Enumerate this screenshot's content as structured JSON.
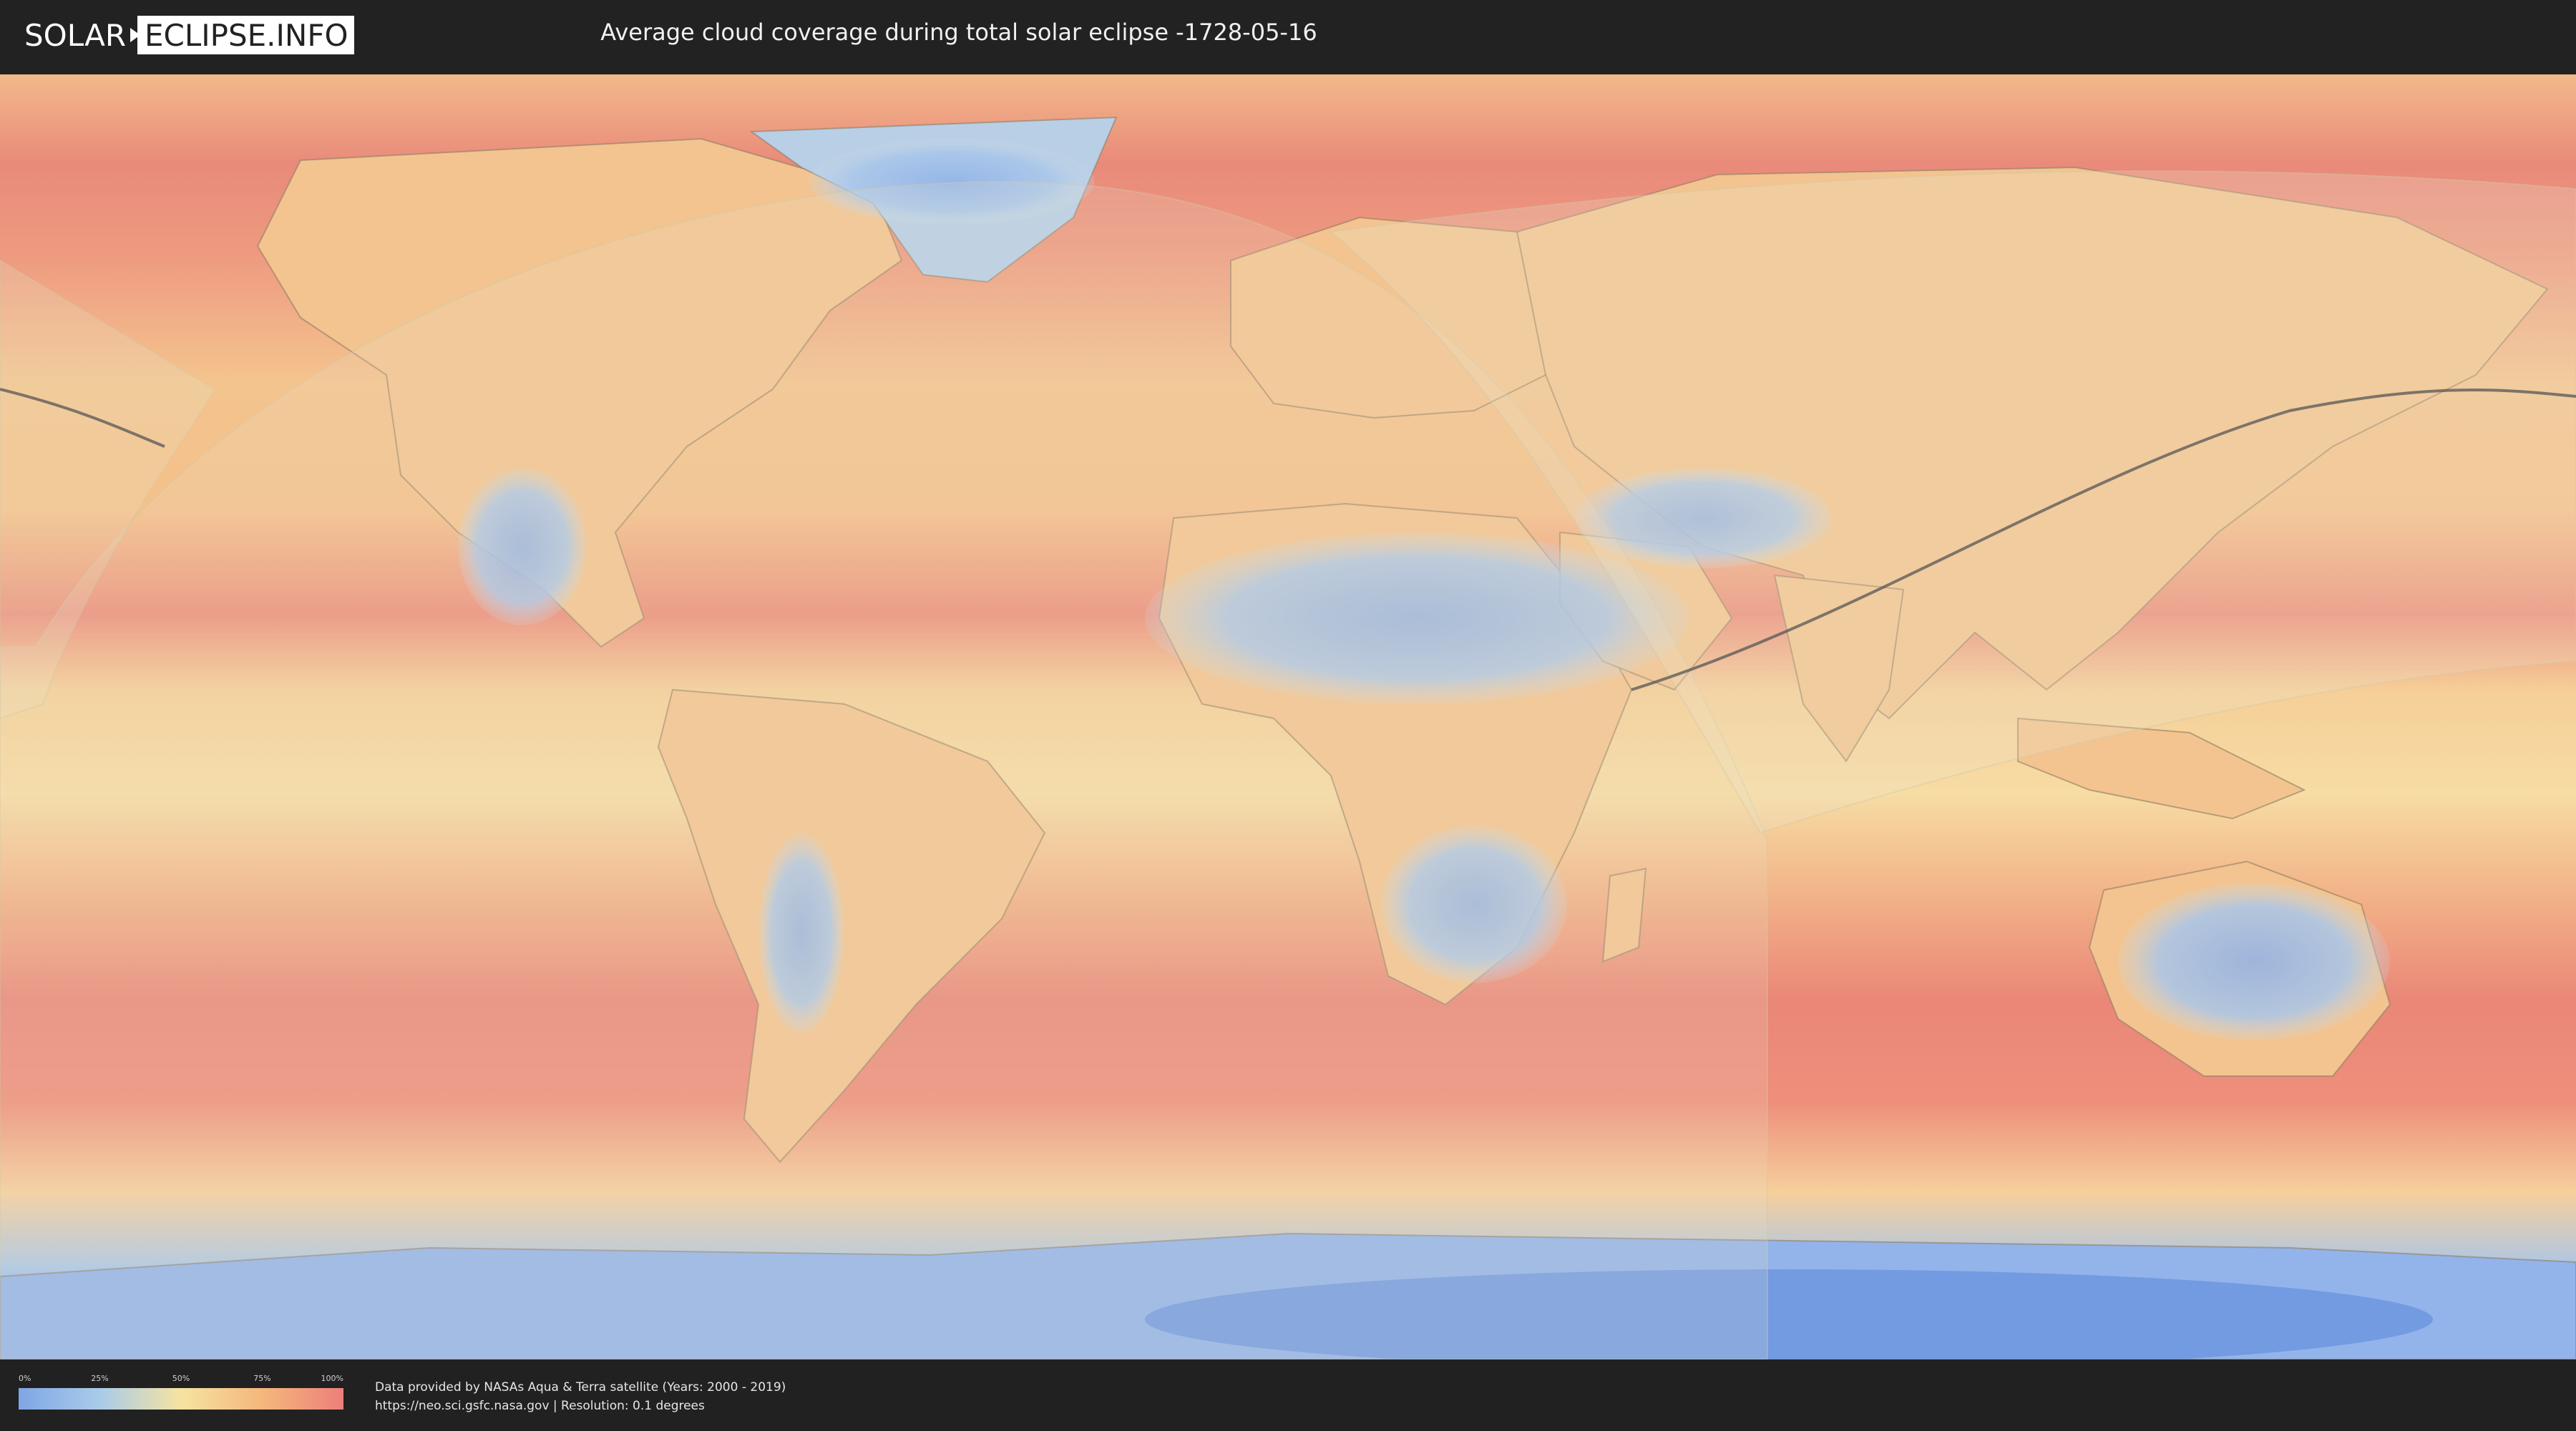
{
  "header": {
    "logo_left": "SOLAR",
    "logo_right": "ECLIPSE.INFO",
    "title": "Average cloud coverage during total solar eclipse -1728-05-16"
  },
  "map": {
    "name": "cloud-coverage-world-map",
    "eclipse_path_color": "#555555",
    "visibility_overlay_color": "#e9e6cf"
  },
  "legend": {
    "ticks": [
      "0%",
      "25%",
      "50%",
      "75%",
      "100%"
    ],
    "colors": [
      "#7fa6e6",
      "#a9cbe9",
      "#f6e3a0",
      "#f4b77c",
      "#ee7f7a"
    ]
  },
  "footer": {
    "credit_line1": "Data provided by NASAs Aqua & Terra satellite (Years: 2000 - 2019)",
    "credit_line2": "https://neo.sci.gsfc.nasa.gov | Resolution: 0.1 degrees"
  }
}
